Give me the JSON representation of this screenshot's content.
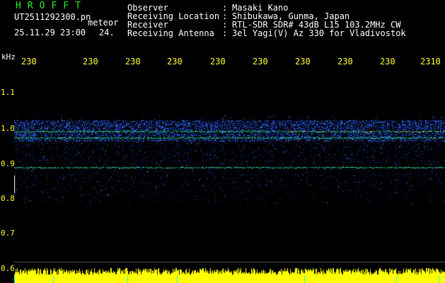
{
  "header": {
    "title": "HROFFT",
    "filename": "UT2511292300.pn",
    "mode": "meteor",
    "datetime": "25.11.29 23:00",
    "count": "24.",
    "info": [
      {
        "key": "Observer",
        "value": "Masaki Kano"
      },
      {
        "key": "Receiving Location",
        "value": "Shibukawa, Gunma, Japan"
      },
      {
        "key": "Receiver",
        "value": "RTL-SDR SDR# 43dB L15 103.2MHz CW"
      },
      {
        "key": "Receiving Antenna",
        "value": "3el Yagi(V) Az 330 for Vladivostok"
      }
    ]
  },
  "axis": {
    "unit": "kHz",
    "x_ticks": [
      "230",
      "230",
      "230",
      "230",
      "230",
      "230",
      "230",
      "230",
      "230",
      "2310"
    ],
    "y_ticks": [
      "1.1",
      "1.0",
      "0.9",
      "0.8",
      "0.7",
      "0.6"
    ]
  },
  "colors": {
    "text": "#ffffff",
    "title": "#22ee22",
    "axis": "#ffff33",
    "signal_line": "#22ee22",
    "noise_bar": "#ffff00",
    "sample_marker": "#00ffff"
  }
}
